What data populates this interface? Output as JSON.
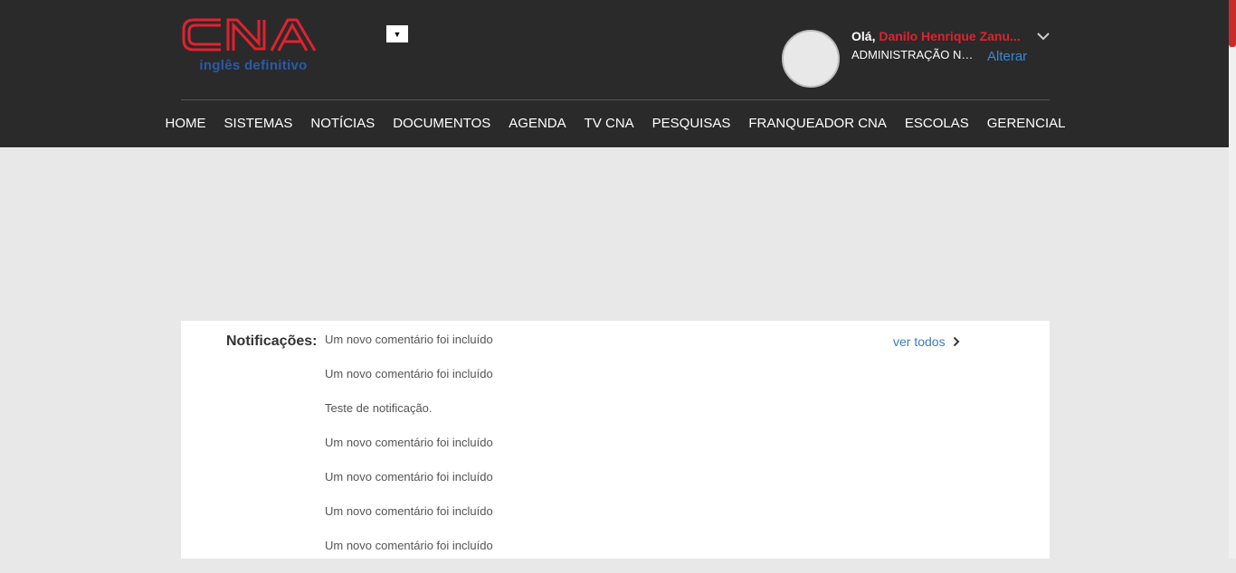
{
  "header": {
    "logo_text": "CNA",
    "logo_tagline": "inglês definitivo",
    "language_select_glyph": "▼",
    "user": {
      "greeting": "Olá,",
      "name": "Danilo Henrique Zanu...",
      "department": "ADMINISTRAÇÃO NA...",
      "change_link": "Alterar"
    }
  },
  "nav": {
    "items": [
      {
        "label": "HOME"
      },
      {
        "label": "SISTEMAS"
      },
      {
        "label": "NOTÍCIAS"
      },
      {
        "label": "DOCUMENTOS"
      },
      {
        "label": "AGENDA"
      },
      {
        "label": "TV CNA"
      },
      {
        "label": "PESQUISAS"
      },
      {
        "label": "FRANQUEADOR CNA"
      },
      {
        "label": "ESCOLAS"
      },
      {
        "label": "GERENCIAL"
      }
    ]
  },
  "notifications": {
    "label": "Notificações:",
    "see_all": "ver todos",
    "items": [
      "Um novo comentário foi incluído",
      "Um novo comentário foi incluído",
      "Teste de notificação.",
      "Um novo comentário foi incluído",
      "Um novo comentário foi incluído",
      "Um novo comentário foi incluído",
      "Um novo comentário foi incluído"
    ]
  },
  "colors": {
    "header_bg": "#2a2a2a",
    "brand_red": "#e0222f",
    "brand_blue": "#2a5aa8",
    "link_blue": "#3a86d4",
    "page_bg": "#e8e8e8"
  },
  "icons": {
    "user_menu": "chevron-down-icon",
    "see_all": "chevron-right-icon",
    "language": "dropdown-arrow-icon"
  }
}
